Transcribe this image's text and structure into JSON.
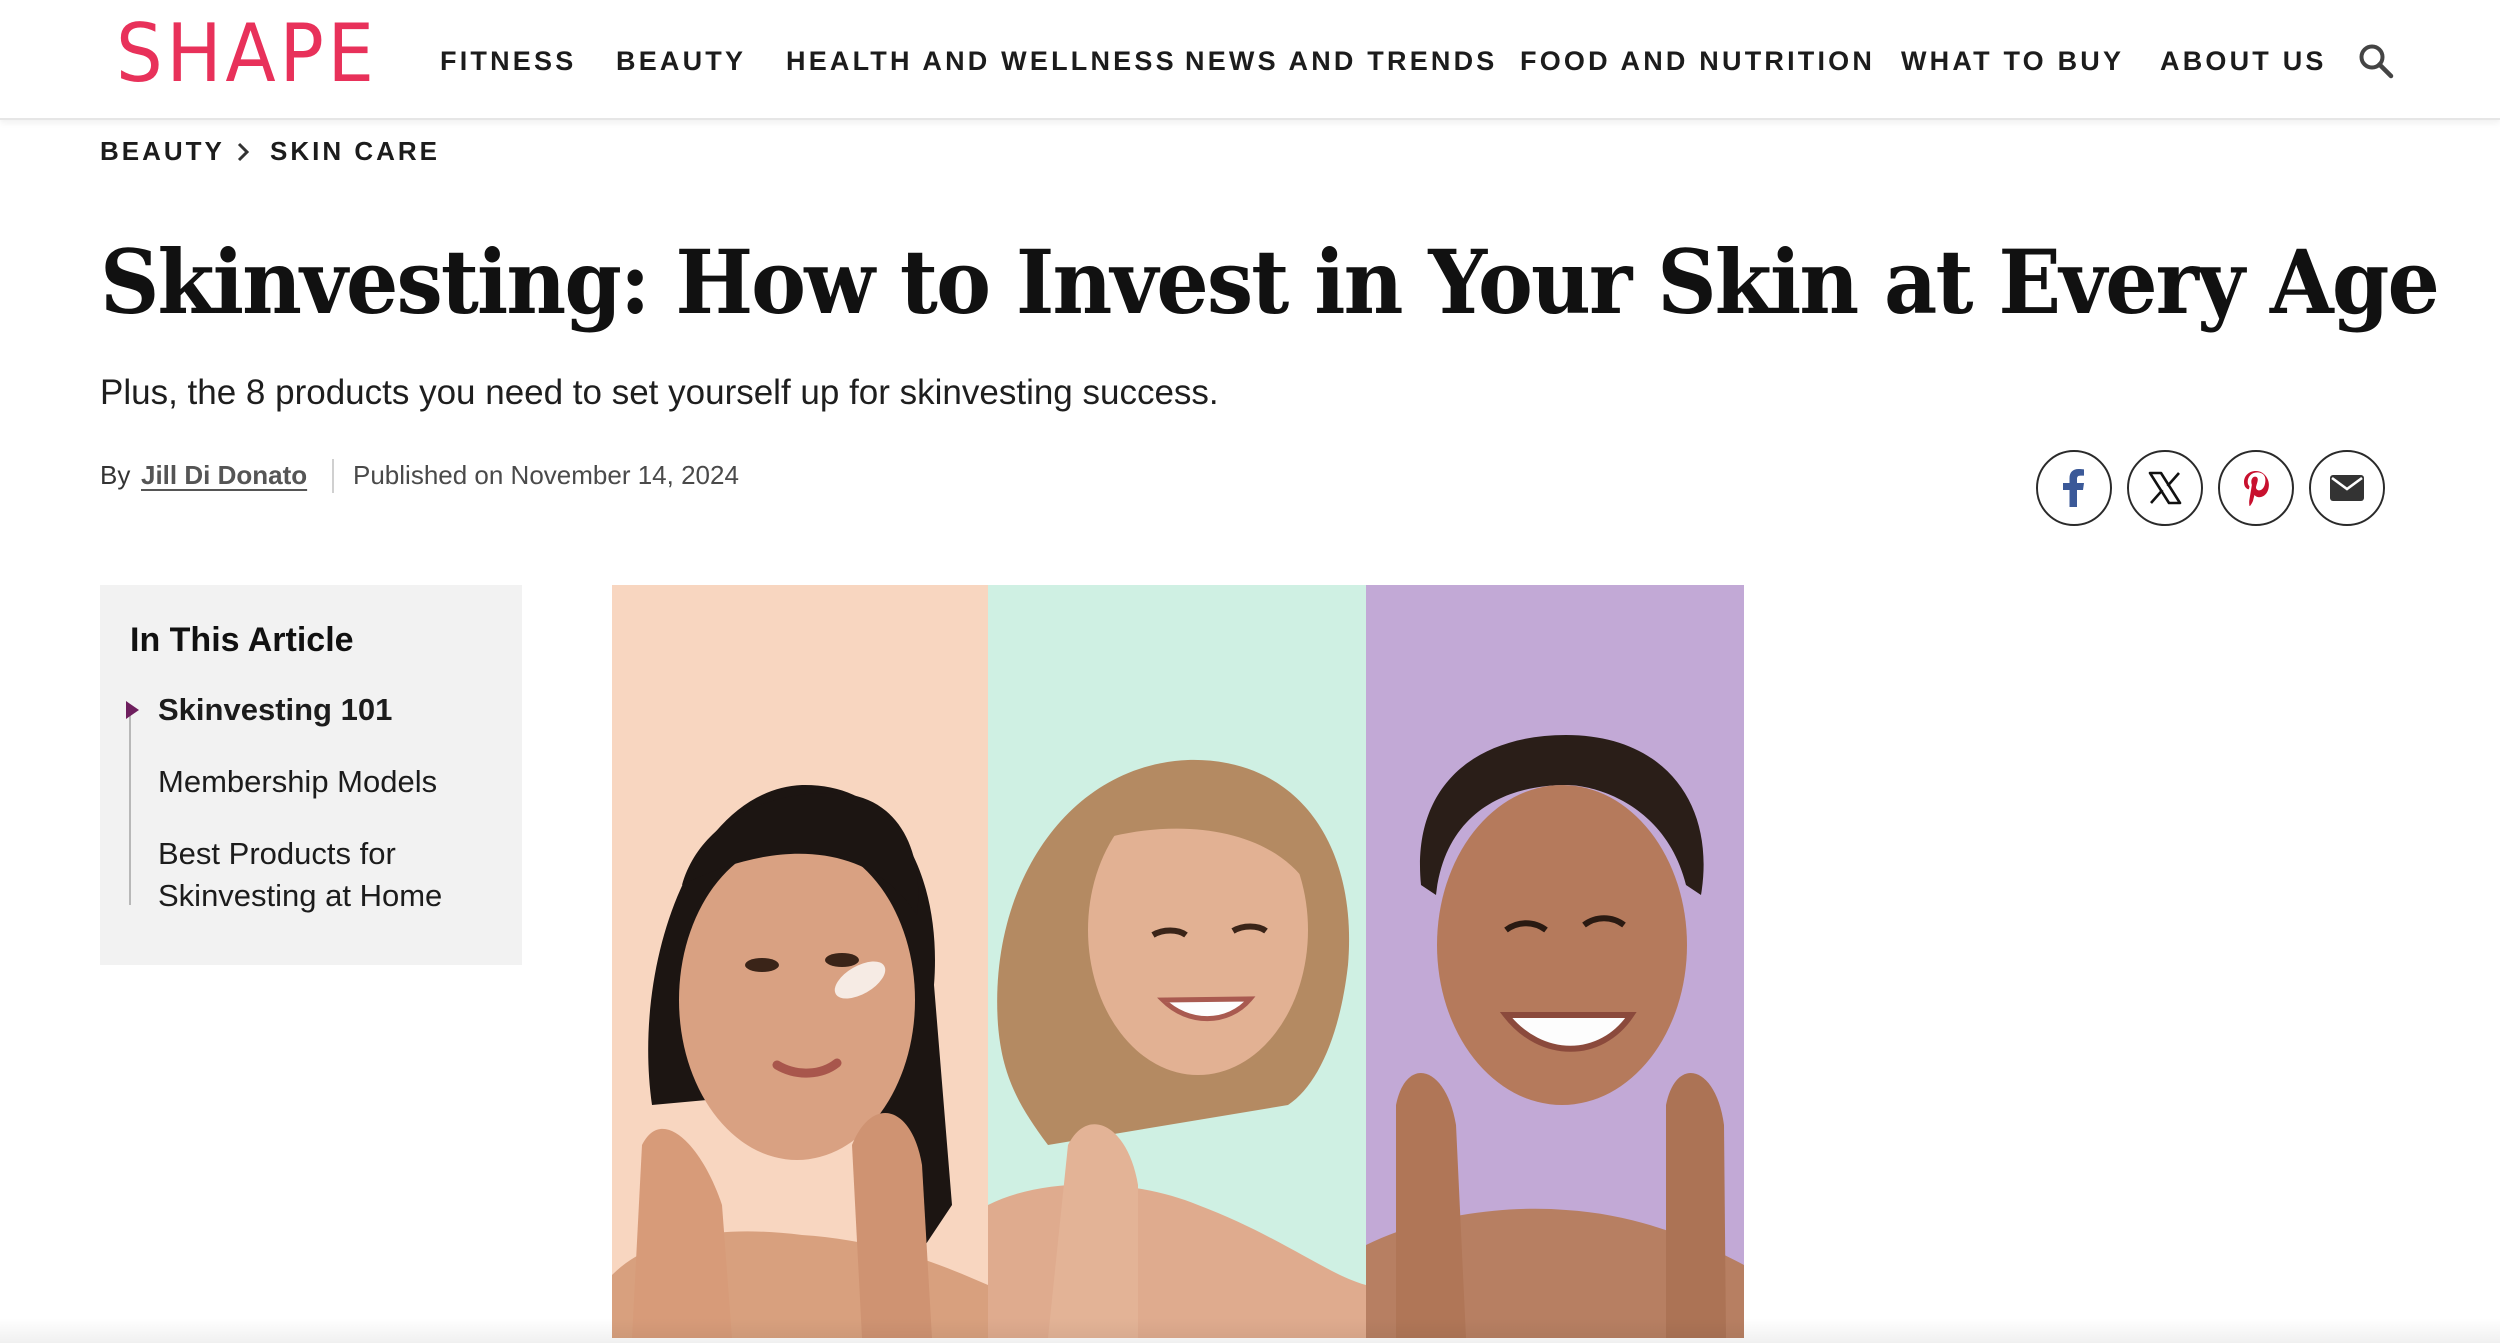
{
  "site": {
    "logo": "SHAPE",
    "brand_color": "#e8315a"
  },
  "nav": {
    "items": [
      {
        "label": "FITNESS"
      },
      {
        "label": "BEAUTY"
      },
      {
        "label": "HEALTH AND WELLNESS"
      },
      {
        "label": "NEWS AND TRENDS"
      },
      {
        "label": "FOOD AND NUTRITION"
      },
      {
        "label": "WHAT TO BUY"
      },
      {
        "label": "ABOUT US"
      }
    ],
    "search_icon": "search-icon"
  },
  "breadcrumb": {
    "items": [
      {
        "label": "BEAUTY"
      },
      {
        "label": "SKIN CARE"
      }
    ],
    "separator_icon": "chevron-right-icon"
  },
  "article": {
    "title": "Skinvesting: How to Invest in Your Skin at Every Age",
    "subtitle": "Plus, the 8 products you need to set yourself up for skinvesting success.",
    "byline": {
      "by_label": "By",
      "author": "Jill Di Donato",
      "published": "Published on November 14, 2024"
    }
  },
  "share": {
    "buttons": [
      {
        "icon": "facebook-icon",
        "color": "#3b5998"
      },
      {
        "icon": "x-icon",
        "color": "#111111"
      },
      {
        "icon": "pinterest-icon",
        "color": "#c8102e"
      },
      {
        "icon": "email-icon",
        "color": "#333333"
      }
    ]
  },
  "toc": {
    "title": "In This Article",
    "items": [
      {
        "label": "Skinvesting 101",
        "active": true
      },
      {
        "label": "Membership Models",
        "active": false
      },
      {
        "label": "Best Products for",
        "label_line2": "Skinvesting at Home",
        "active": false
      }
    ],
    "accent_color": "#6e1f5e"
  },
  "hero": {
    "panel_colors": [
      "#f8d6c0",
      "#cff0e3",
      "#c2a9d6"
    ]
  }
}
